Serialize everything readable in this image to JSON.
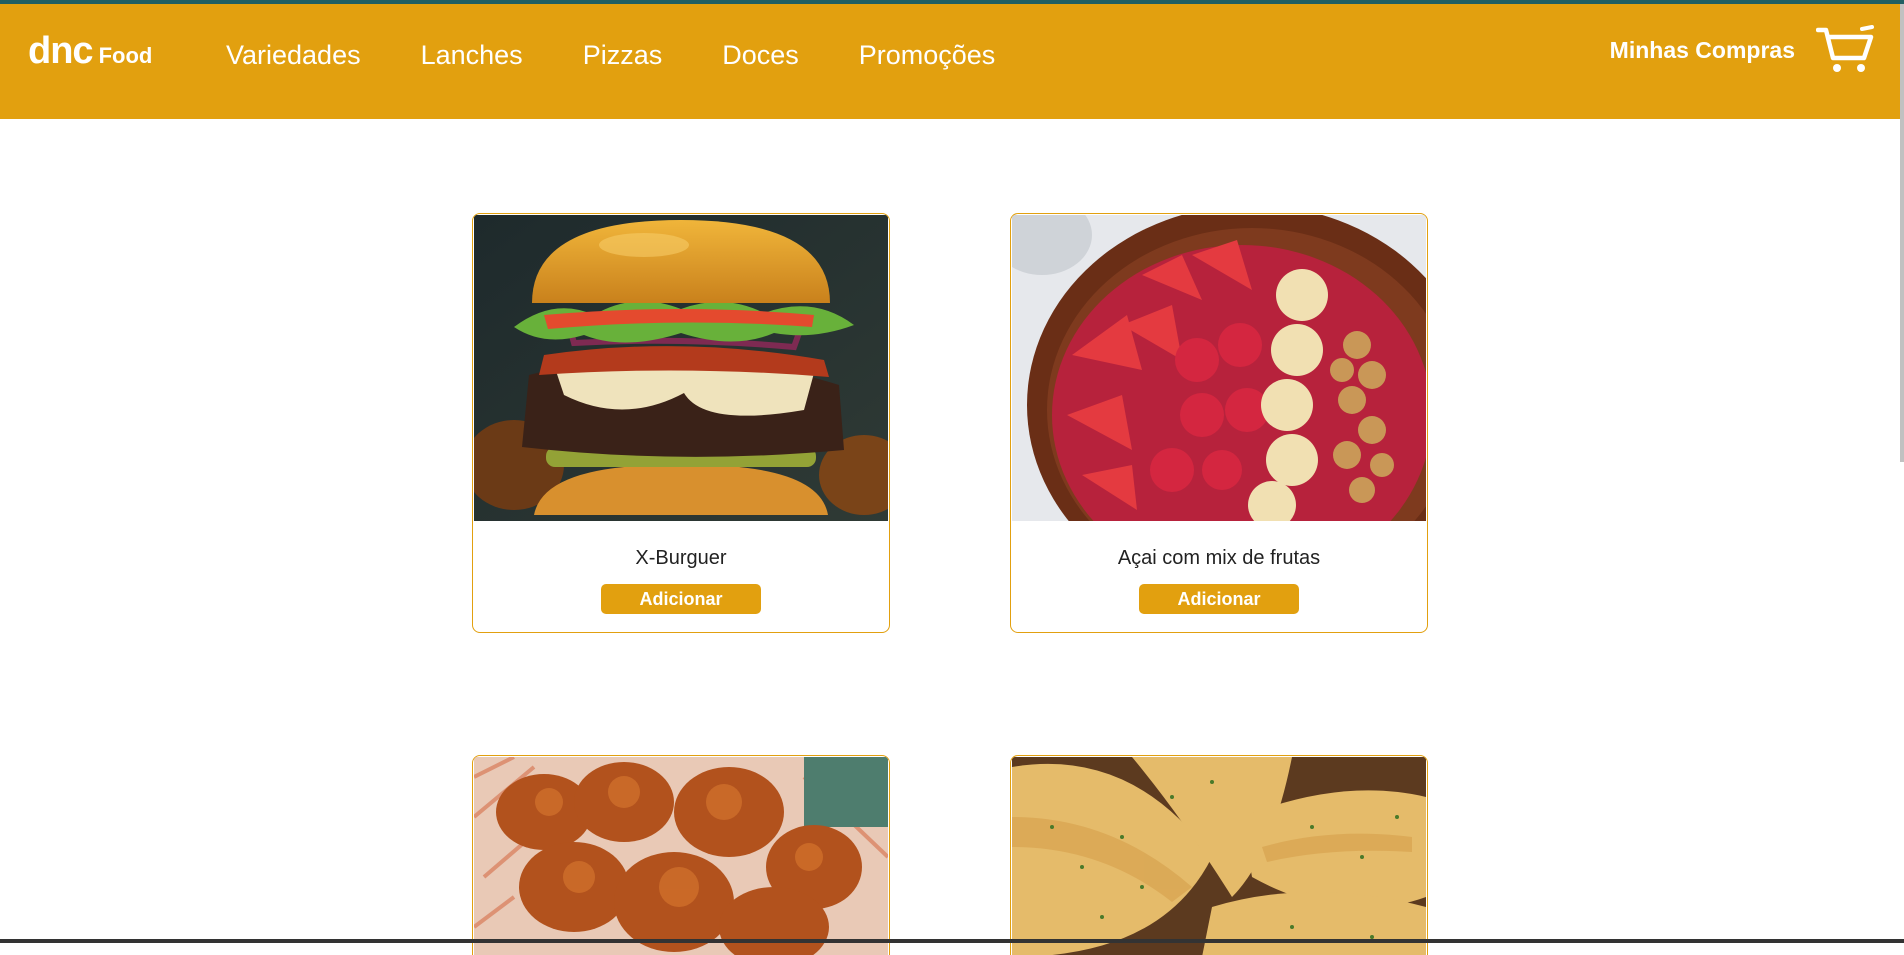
{
  "header": {
    "logo_main": "dnc",
    "logo_sub": "Food",
    "nav": [
      "Variedades",
      "Lanches",
      "Pizzas",
      "Doces",
      "Promoções"
    ],
    "my_purchases": "Minhas Compras",
    "cart_icon": "shopping-cart-icon"
  },
  "products": [
    {
      "name": "X-Burguer",
      "button": "Adicionar",
      "image": "burger-photo"
    },
    {
      "name": "Açai com mix de frutas",
      "button": "Adicionar",
      "image": "acai-bowl-photo"
    },
    {
      "image": "fried-chicken-photo"
    },
    {
      "image": "pastel-photo"
    }
  ],
  "colors": {
    "accent": "#e2a00f",
    "top_bar": "#1f5f63",
    "text": "#222222"
  }
}
